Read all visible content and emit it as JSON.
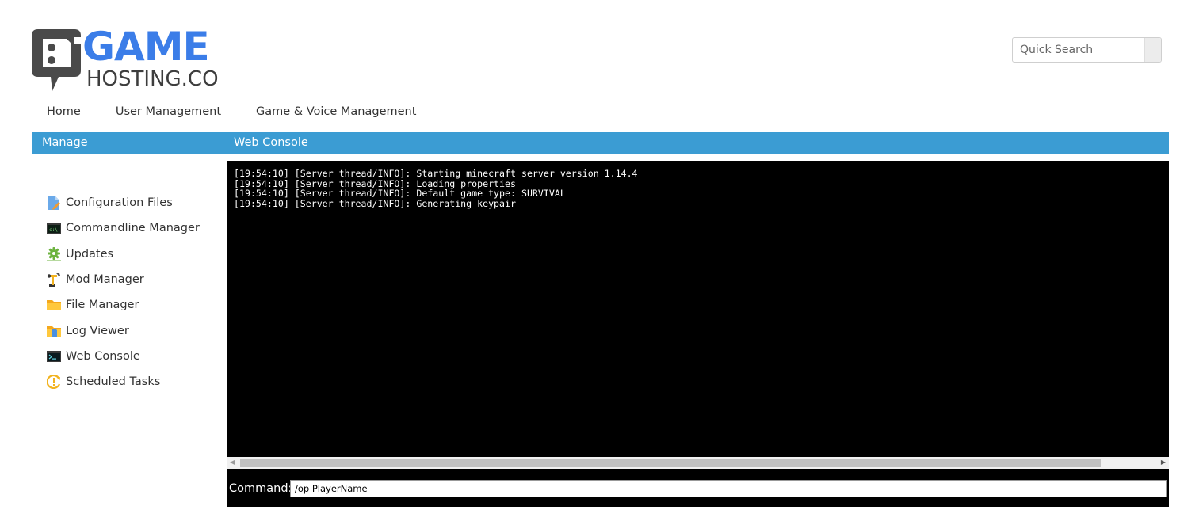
{
  "logo": {
    "line1": "GAME",
    "line2": "HOSTING.CO",
    "brand_color": "#3b7de8",
    "mark_color": "#4a4a4a"
  },
  "search": {
    "placeholder": "Quick Search",
    "value": ""
  },
  "nav": {
    "items": [
      {
        "label": "Home"
      },
      {
        "label": "User Management"
      },
      {
        "label": "Game & Voice Management"
      }
    ]
  },
  "header": {
    "left_title": "Manage",
    "right_title": "Web Console",
    "bar_color": "#3b9cd3"
  },
  "sidebar": {
    "items": [
      {
        "label": "Configuration Files",
        "icon": "config-file-icon"
      },
      {
        "label": "Commandline Manager",
        "icon": "terminal-icon"
      },
      {
        "label": "Updates",
        "icon": "gear-icon"
      },
      {
        "label": "Mod Manager",
        "icon": "robot-arm-icon"
      },
      {
        "label": "File Manager",
        "icon": "folder-icon"
      },
      {
        "label": "Log Viewer",
        "icon": "log-folder-icon"
      },
      {
        "label": "Web Console",
        "icon": "console-icon"
      },
      {
        "label": "Scheduled Tasks",
        "icon": "clock-alert-icon"
      }
    ]
  },
  "console": {
    "lines": [
      "[19:54:10] [Server thread/INFO]: Starting minecraft server version 1.14.4",
      "[19:54:10] [Server thread/INFO]: Loading properties",
      "[19:54:10] [Server thread/INFO]: Default game type: SURVIVAL",
      "[19:54:10] [Server thread/INFO]: Generating keypair"
    ]
  },
  "command": {
    "label": "Command:",
    "value": "/op PlayerName"
  }
}
